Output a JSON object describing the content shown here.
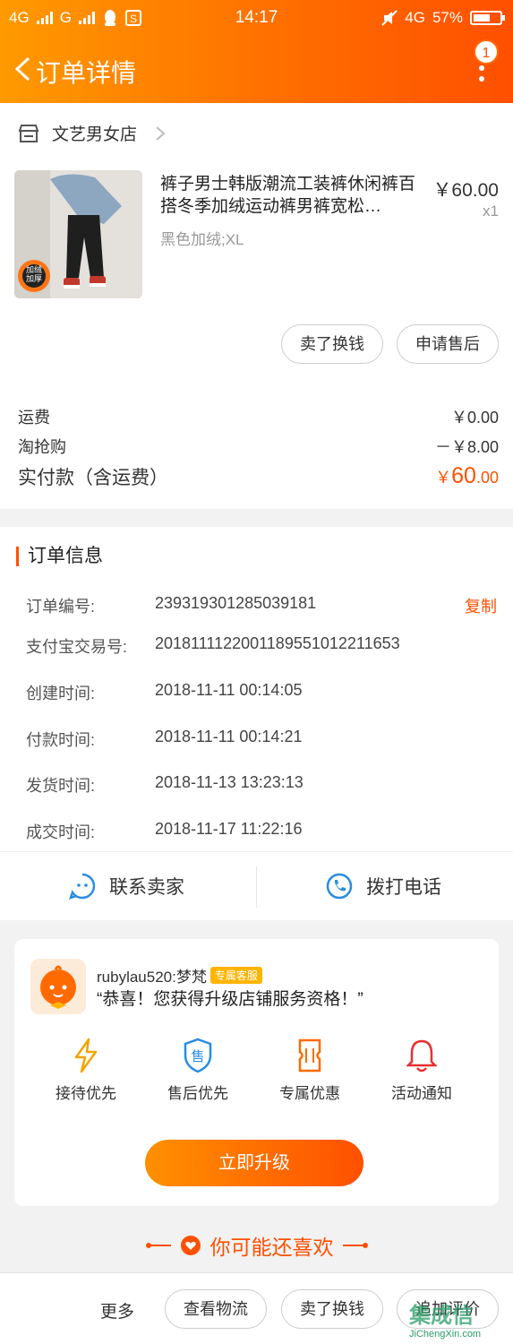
{
  "status_bar": {
    "network_left": "4G",
    "network_left_2": "G",
    "time": "14:17",
    "network_right": "4G",
    "battery": "57%"
  },
  "nav": {
    "title": "订单详情",
    "badge_count": "1"
  },
  "shop": {
    "name": "文艺男女店"
  },
  "product": {
    "title": "裤子男士韩版潮流工装裤休闲裤百搭冬季加绒运动裤男裤宽松…",
    "spec": "黑色加绒;XL",
    "price": "￥60.00",
    "qty": "x1",
    "thumb_badge": "加绒加厚"
  },
  "item_actions": {
    "sell": "卖了换钱",
    "after_sale": "申请售后"
  },
  "fees": {
    "shipping_label": "运费",
    "shipping_value": "￥0.00",
    "discount_label": "淘抢购",
    "discount_value": "－￥8.00",
    "total_label": "实付款（含运费）",
    "total_currency": "￥",
    "total_int": "60",
    "total_dec": ".00"
  },
  "order_info": {
    "title": "订单信息",
    "copy_label": "复制",
    "rows": [
      {
        "label": "订单编号:",
        "value": "239319301285039181"
      },
      {
        "label": "支付宝交易号:",
        "value": "2018111122001189551012211653"
      },
      {
        "label": "创建时间:",
        "value": "2018-11-11 00:14:05"
      },
      {
        "label": "付款时间:",
        "value": "2018-11-11 00:14:21"
      },
      {
        "label": "发货时间:",
        "value": "2018-11-13 13:23:13"
      },
      {
        "label": "成交时间:",
        "value": "2018-11-17 11:22:16"
      }
    ]
  },
  "contact": {
    "seller": "联系卖家",
    "phone": "拨打电话"
  },
  "service": {
    "name": "rubylau520:梦梵",
    "tag": "专属客服",
    "message": "“恭喜！您获得升级店铺服务资格！”",
    "perks": [
      "接待优先",
      "售后优先",
      "专属优惠",
      "活动通知"
    ],
    "perk_icon_text": "售",
    "upgrade": "立即升级"
  },
  "recommend": {
    "title": "你可能还喜欢"
  },
  "bottom_bar": {
    "more": "更多",
    "logistics": "查看物流",
    "sell": "卖了换钱",
    "review": "追加评价"
  },
  "watermark": {
    "big": "集成信",
    "small": "JiChengXin.com"
  },
  "colors": {
    "accent": "#ff5000",
    "header_start": "#ff9a00",
    "link_blue": "#2a8ce0"
  }
}
